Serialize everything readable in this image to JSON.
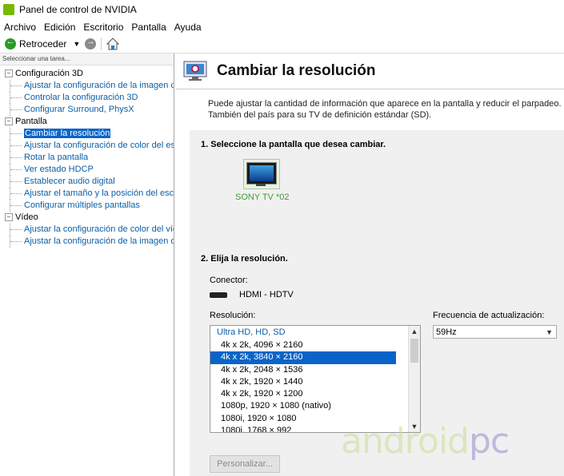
{
  "window": {
    "title": "Panel de control de NVIDIA"
  },
  "menu": [
    "Archivo",
    "Edición",
    "Escritorio",
    "Pantalla",
    "Ayuda"
  ],
  "toolbar": {
    "back_label": "Retroceder"
  },
  "sidebar": {
    "header": "Seleccionar una tarea...",
    "groups": [
      {
        "label": "Configuración 3D",
        "items": [
          "Ajustar la configuración de la imagen con",
          "Controlar la configuración 3D",
          "Configurar Surround, PhysX"
        ]
      },
      {
        "label": "Pantalla",
        "items": [
          "Cambiar la resolución",
          "Ajustar la configuración de color del escri",
          "Rotar la pantalla",
          "Ver estado HDCP",
          "Establecer audio digital",
          "Ajustar el tamaño y la posición del escrito",
          "Configurar múltiples pantallas"
        ]
      },
      {
        "label": "Vídeo",
        "items": [
          "Ajustar la configuración de color del víde",
          "Ajustar la configuración de la imagen de v"
        ]
      }
    ],
    "selected": "Cambiar la resolución"
  },
  "main": {
    "title": "Cambiar la resolución",
    "description": "Puede ajustar la cantidad de información que aparece en la pantalla y reducir el parpadeo. También del país para su TV de definición estándar (SD).",
    "step1": "1. Seleccione la pantalla que desea cambiar.",
    "display_label": "SONY TV  *02",
    "step2": "2. Elija la resolución.",
    "connector_label": "Conector:",
    "connector_value": "HDMI - HDTV",
    "resolution_label": "Resolución:",
    "resolution_group": "Ultra HD, HD, SD",
    "resolutions": [
      "4k x 2k, 4096 × 2160",
      "4k x 2k, 3840 × 2160",
      "4k x 2k, 2048 × 1536",
      "4k x 2k, 1920 × 1440",
      "4k x 2k, 1920 × 1200",
      "1080p, 1920 × 1080 (nativo)",
      "1080i, 1920 × 1080",
      "1080i, 1768 × 992"
    ],
    "selected_resolution": "4k x 2k, 3840 × 2160",
    "frequency_label": "Frecuencia de actualización:",
    "frequency_value": "59Hz",
    "customize_button": "Personalizar..."
  },
  "watermark": {
    "part1": "android",
    "part2": "pc"
  },
  "colors": {
    "selection": "#0a64c8",
    "link": "#0b5fa8",
    "nvidia_green": "#76b900"
  },
  "icons": [
    "nvidia-logo-icon",
    "back-arrow-icon",
    "forward-arrow-icon",
    "home-icon",
    "monitor-icon",
    "hdmi-icon",
    "display-settings-icon"
  ]
}
